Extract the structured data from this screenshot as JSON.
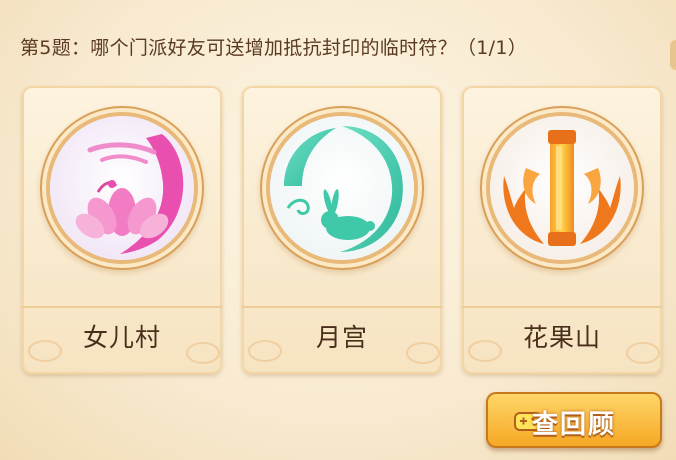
{
  "question": {
    "text": "第5题：哪个门派好友可送增加抵抗封印的临时符？（1/1）"
  },
  "options": [
    {
      "label": "女儿村",
      "icon": "lotus-emblem-icon",
      "color": "#e45fb4"
    },
    {
      "label": "月宫",
      "icon": "moon-rabbit-emblem-icon",
      "color": "#3fc9a8"
    },
    {
      "label": "花果山",
      "icon": "golden-staff-emblem-icon",
      "color": "#f0781c"
    }
  ],
  "review_button": {
    "label": "查回顾",
    "icon": "gamepad-icon"
  },
  "theme": {
    "card_border": "#eccb97",
    "text": "#4a2e1c",
    "button": "#f5a623"
  }
}
